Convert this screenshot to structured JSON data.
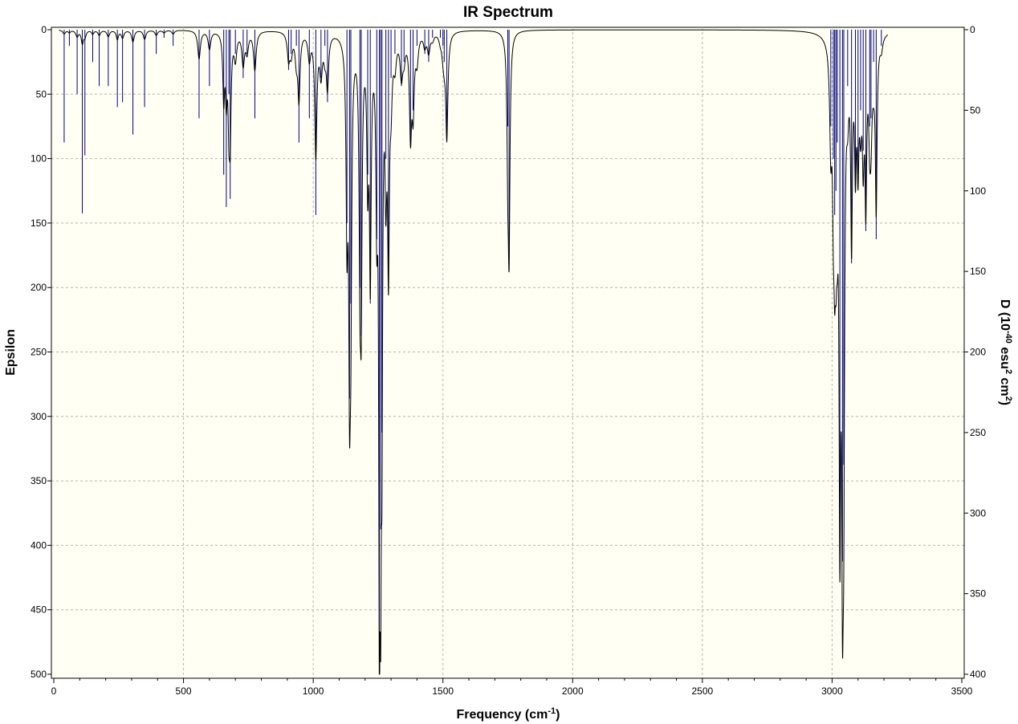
{
  "chart_data": {
    "type": "line",
    "title": "IR Spectrum",
    "xlabel": "Frequency (cm",
    "xlabel_sup": "-1",
    "xlabel_end": ")",
    "ylabel_left": "Epsilon",
    "ylabel_right_parts": [
      "D (10",
      "-40",
      " esu",
      "2",
      " cm",
      "2",
      ")"
    ],
    "xlim": [
      0,
      3500
    ],
    "ylim_left": [
      0,
      500
    ],
    "ylim_right": [
      0,
      400
    ],
    "x_ticks": [
      "0",
      "500",
      "1000",
      "1500",
      "2000",
      "2500",
      "3000",
      "3500"
    ],
    "y_ticks_left": [
      "0",
      "50",
      "100",
      "150",
      "200",
      "250",
      "300",
      "350",
      "400",
      "450",
      "500"
    ],
    "y_ticks_right": [
      "0",
      "50",
      "100",
      "150",
      "200",
      "250",
      "300",
      "350",
      "400"
    ],
    "y_inverted": true,
    "grid": true,
    "colors": {
      "plot_bg": "#fffff4",
      "curve": "#000000",
      "sticks": "#00007f",
      "grid": "#b4b4b4"
    },
    "stick_series": {
      "name": "D",
      "x": [
        40,
        60,
        90,
        110,
        120,
        150,
        175,
        210,
        245,
        265,
        305,
        350,
        395,
        425,
        460,
        560,
        600,
        655,
        665,
        675,
        680,
        700,
        730,
        745,
        775,
        905,
        915,
        935,
        945,
        985,
        1010,
        1030,
        1045,
        1055,
        1130,
        1140,
        1145,
        1180,
        1185,
        1210,
        1220,
        1245,
        1255,
        1260,
        1265,
        1280,
        1290,
        1300,
        1315,
        1340,
        1350,
        1375,
        1385,
        1400,
        1430,
        1445,
        1460,
        1490,
        1500,
        1505,
        1515,
        1750,
        1755,
        2995,
        3005,
        3010,
        3015,
        3020,
        3030,
        3040,
        3045,
        3060,
        3075,
        3090,
        3100,
        3110,
        3120,
        3130,
        3145,
        3150,
        3160,
        3170,
        3190
      ],
      "y": [
        70,
        10,
        40,
        114,
        78,
        20,
        35,
        35,
        48,
        45,
        65,
        48,
        15,
        5,
        10,
        55,
        35,
        90,
        110,
        40,
        105,
        15,
        30,
        15,
        55,
        25,
        15,
        10,
        70,
        55,
        115,
        30,
        10,
        45,
        120,
        229,
        170,
        160,
        190,
        90,
        170,
        130,
        400,
        310,
        250,
        80,
        160,
        30,
        15,
        35,
        20,
        70,
        50,
        10,
        15,
        20,
        5,
        5,
        10,
        20,
        70,
        60,
        150,
        60,
        80,
        115,
        100,
        70,
        320,
        330,
        270,
        35,
        145,
        95,
        90,
        50,
        75,
        125,
        60,
        55,
        20,
        130,
        10
      ]
    },
    "curve_series": {
      "name": "Epsilon",
      "peaks": [
        [
          40,
          3,
          6
        ],
        [
          60,
          2,
          5
        ],
        [
          90,
          5,
          6
        ],
        [
          110,
          10,
          5
        ],
        [
          120,
          5,
          5
        ],
        [
          150,
          3,
          5
        ],
        [
          175,
          4,
          6
        ],
        [
          210,
          5,
          6
        ],
        [
          245,
          7,
          5
        ],
        [
          265,
          6,
          6
        ],
        [
          305,
          9,
          6
        ],
        [
          350,
          7,
          6
        ],
        [
          395,
          4,
          6
        ],
        [
          425,
          2,
          6
        ],
        [
          460,
          3,
          6
        ],
        [
          560,
          22,
          6
        ],
        [
          600,
          14,
          6
        ],
        [
          655,
          50,
          4
        ],
        [
          665,
          45,
          4
        ],
        [
          675,
          60,
          4
        ],
        [
          680,
          70,
          4
        ],
        [
          700,
          20,
          6
        ],
        [
          730,
          25,
          6
        ],
        [
          745,
          15,
          6
        ],
        [
          775,
          30,
          6
        ],
        [
          905,
          20,
          6
        ],
        [
          915,
          15,
          6
        ],
        [
          935,
          20,
          6
        ],
        [
          945,
          50,
          5
        ],
        [
          985,
          20,
          6
        ],
        [
          1010,
          95,
          5
        ],
        [
          1030,
          30,
          6
        ],
        [
          1045,
          15,
          6
        ],
        [
          1055,
          40,
          5
        ],
        [
          1130,
          140,
          4
        ],
        [
          1140,
          230,
          4
        ],
        [
          1145,
          170,
          4
        ],
        [
          1180,
          150,
          4
        ],
        [
          1185,
          180,
          4
        ],
        [
          1210,
          100,
          4
        ],
        [
          1220,
          180,
          4
        ],
        [
          1245,
          120,
          4
        ],
        [
          1255,
          400,
          3
        ],
        [
          1260,
          300,
          3
        ],
        [
          1265,
          240,
          3
        ],
        [
          1280,
          100,
          4
        ],
        [
          1290,
          170,
          4
        ],
        [
          1300,
          40,
          5
        ],
        [
          1315,
          20,
          6
        ],
        [
          1340,
          30,
          6
        ],
        [
          1350,
          15,
          6
        ],
        [
          1375,
          75,
          5
        ],
        [
          1385,
          55,
          5
        ],
        [
          1400,
          20,
          6
        ],
        [
          1430,
          10,
          6
        ],
        [
          1445,
          15,
          6
        ],
        [
          1460,
          5,
          6
        ],
        [
          1490,
          5,
          6
        ],
        [
          1500,
          10,
          6
        ],
        [
          1505,
          15,
          6
        ],
        [
          1515,
          80,
          5
        ],
        [
          1750,
          80,
          4
        ],
        [
          1755,
          155,
          4
        ],
        [
          2995,
          75,
          5
        ],
        [
          3005,
          90,
          4
        ],
        [
          3010,
          110,
          4
        ],
        [
          3015,
          90,
          4
        ],
        [
          3020,
          70,
          4
        ],
        [
          3030,
          340,
          4
        ],
        [
          3040,
          320,
          4
        ],
        [
          3045,
          260,
          4
        ],
        [
          3060,
          35,
          5
        ],
        [
          3075,
          150,
          4
        ],
        [
          3090,
          90,
          4
        ],
        [
          3100,
          85,
          4
        ],
        [
          3110,
          55,
          5
        ],
        [
          3120,
          80,
          4
        ],
        [
          3130,
          120,
          4
        ],
        [
          3145,
          60,
          5
        ],
        [
          3150,
          55,
          5
        ],
        [
          3160,
          20,
          6
        ],
        [
          3170,
          130,
          4
        ],
        [
          3190,
          10,
          6
        ]
      ],
      "x_range": [
        20,
        3215
      ]
    }
  }
}
